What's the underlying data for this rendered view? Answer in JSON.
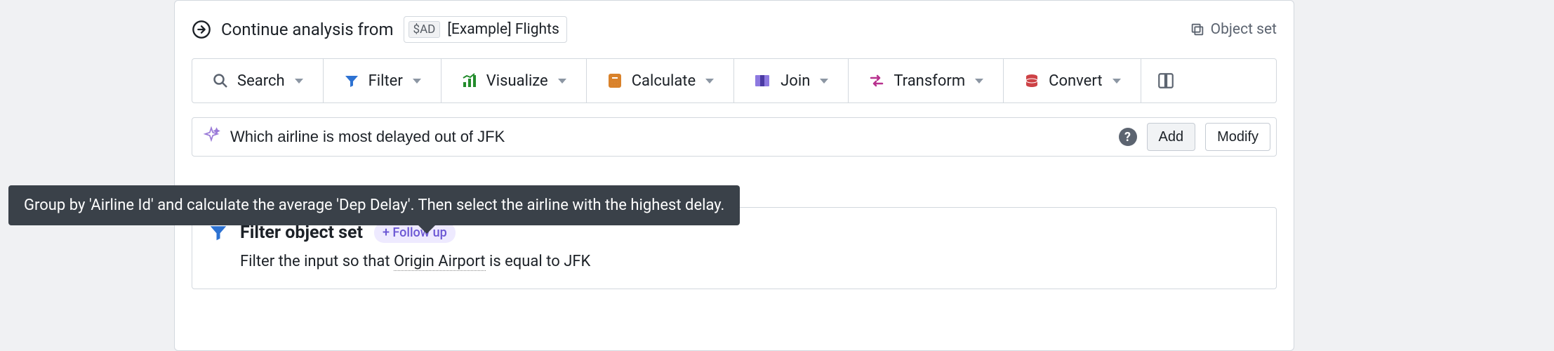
{
  "header": {
    "prefix": "Continue analysis from",
    "chip_badge": "$AD",
    "chip_label": "[Example] Flights",
    "object_set_label": "Object set"
  },
  "toolbar": {
    "search": "Search",
    "filter": "Filter",
    "visualize": "Visualize",
    "calculate": "Calculate",
    "join": "Join",
    "transform": "Transform",
    "convert": "Convert"
  },
  "query": {
    "value": "Which airline is most delayed out of JFK",
    "add_label": "Add",
    "modify_label": "Modify"
  },
  "tooltip": "Group by 'Airline Id' and calculate the average 'Dep Delay'. Then select the airline with the highest delay.",
  "result": {
    "title": "Filter object set",
    "follow_up_label": "+ Follow up",
    "desc_prefix": "Filter the input so that ",
    "desc_field": "Origin Airport",
    "desc_suffix": " is equal to JFK"
  }
}
